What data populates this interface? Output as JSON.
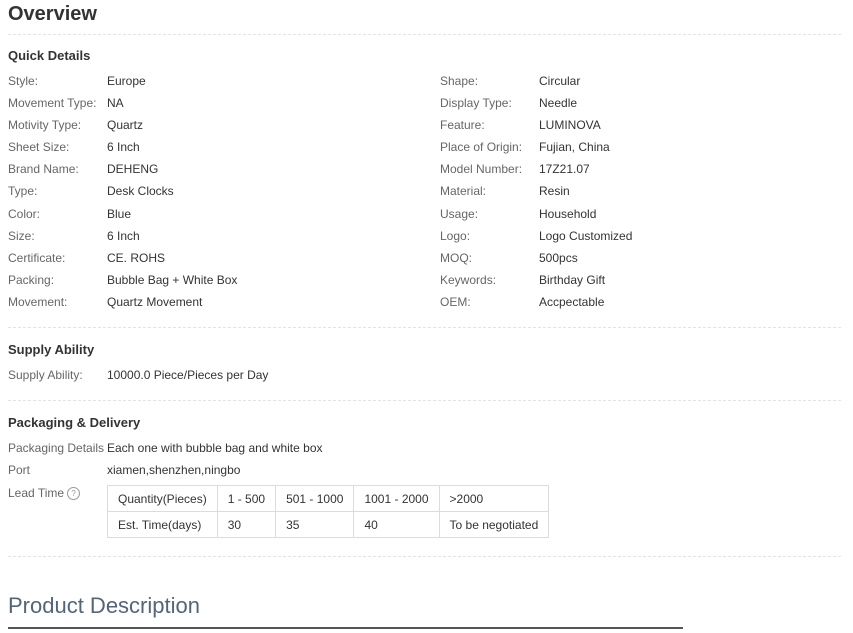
{
  "overview": {
    "title": "Overview"
  },
  "quick_details": {
    "title": "Quick Details",
    "left": [
      {
        "label": "Style:",
        "value": "Europe"
      },
      {
        "label": "Movement Type:",
        "value": "NA"
      },
      {
        "label": "Motivity Type:",
        "value": "Quartz"
      },
      {
        "label": "Sheet Size:",
        "value": "6 Inch"
      },
      {
        "label": "Brand Name:",
        "value": "DEHENG"
      },
      {
        "label": "Type:",
        "value": "Desk Clocks"
      },
      {
        "label": "Color:",
        "value": "Blue"
      },
      {
        "label": "Size:",
        "value": "6 Inch"
      },
      {
        "label": "Certificate:",
        "value": "CE. ROHS"
      },
      {
        "label": "Packing:",
        "value": "Bubble Bag + White Box"
      },
      {
        "label": "Movement:",
        "value": "Quartz Movement"
      }
    ],
    "right": [
      {
        "label": "Shape:",
        "value": "Circular"
      },
      {
        "label": "Display Type:",
        "value": "Needle"
      },
      {
        "label": "Feature:",
        "value": "LUMINOVA"
      },
      {
        "label": "Place of Origin:",
        "value": "Fujian, China"
      },
      {
        "label": "Model Number:",
        "value": "17Z21.07"
      },
      {
        "label": "Material:",
        "value": "Resin"
      },
      {
        "label": "Usage:",
        "value": "Household"
      },
      {
        "label": "Logo:",
        "value": "Logo Customized"
      },
      {
        "label": "MOQ:",
        "value": "500pcs"
      },
      {
        "label": "Keywords:",
        "value": "Birthday Gift"
      },
      {
        "label": "OEM:",
        "value": "Accpectable"
      }
    ]
  },
  "supply_ability": {
    "title": "Supply Ability",
    "label": "Supply Ability:",
    "value": "10000.0 Piece/Pieces per Day"
  },
  "packaging": {
    "title": "Packaging & Delivery",
    "details_label": "Packaging Details",
    "details_value": "Each one with bubble bag and white box",
    "port_label": "Port",
    "port_value": "xiamen,shenzhen,ningbo",
    "lead_time_label": "Lead Time",
    "help_icon_glyph": "?",
    "lead_table": {
      "rows": [
        [
          "Quantity(Pieces)",
          "1 - 500",
          "501 - 1000",
          "1001 - 2000",
          ">2000"
        ],
        [
          "Est. Time(days)",
          "30",
          "35",
          "40",
          "To be negotiated"
        ]
      ]
    }
  },
  "product_description": {
    "title": "Product Description"
  }
}
